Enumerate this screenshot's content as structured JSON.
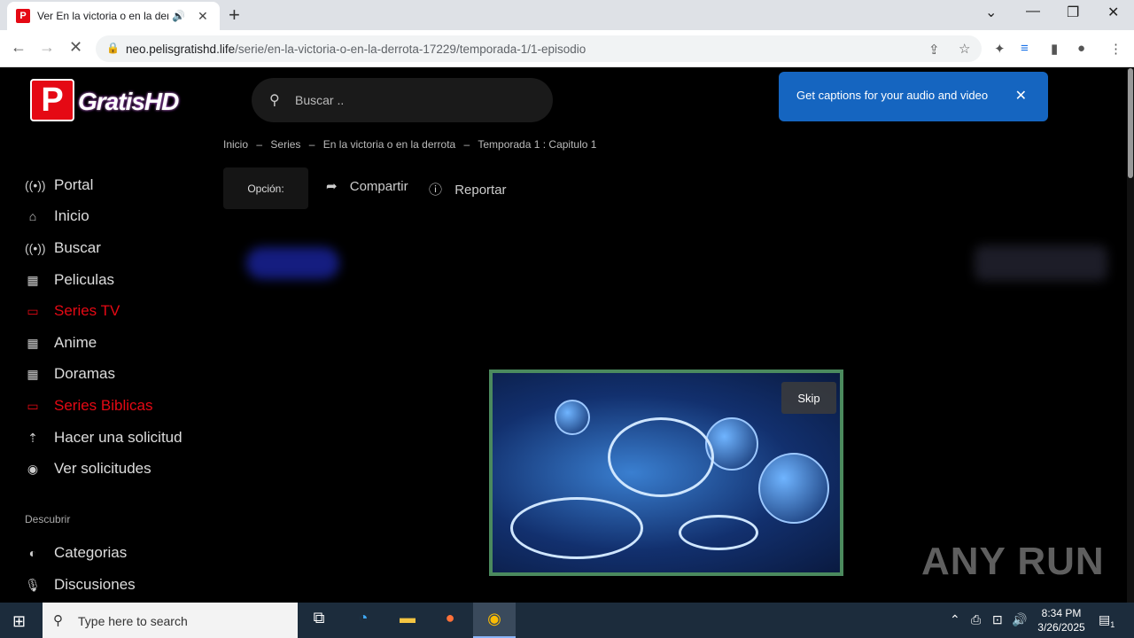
{
  "browser": {
    "tab_title": "Ver En la victoria o en la derr",
    "favicon_letter": "P",
    "audio_icon": "speaker-icon",
    "url_host": "neo.pelisgratishd.life",
    "url_path": "/serie/en-la-victoria-o-en-la-derrota-17229/temporada-1/1-episodio"
  },
  "site": {
    "logo_letter": "P",
    "logo_text": "GratisHD",
    "search_placeholder": "Buscar ..",
    "captions_popup": {
      "text": "Get captions for your audio and video",
      "close": "✕"
    },
    "breadcrumb": {
      "items": [
        "Inicio",
        "Series",
        "En la victoria o en la derrota",
        "Temporada 1 : Capitulo 1"
      ],
      "separator": "–"
    },
    "actions": {
      "option_label": "Opción:",
      "share_label": "Compartir",
      "report_label": "Reportar"
    },
    "sidebar": {
      "items": [
        {
          "label": "Portal",
          "icon": "broadcast-icon",
          "highlight": false
        },
        {
          "label": "Inicio",
          "icon": "home-icon",
          "highlight": false
        },
        {
          "label": "Buscar",
          "icon": "broadcast-icon",
          "highlight": false
        },
        {
          "label": "Peliculas",
          "icon": "film-icon",
          "highlight": false
        },
        {
          "label": "Series TV",
          "icon": "tv-icon",
          "highlight": true
        },
        {
          "label": "Anime",
          "icon": "film-icon",
          "highlight": false
        },
        {
          "label": "Doramas",
          "icon": "film-icon",
          "highlight": false
        },
        {
          "label": "Series Biblicas",
          "icon": "tv-icon",
          "highlight": true
        },
        {
          "label": "Hacer una solicitud",
          "icon": "upload-icon",
          "highlight": false
        },
        {
          "label": "Ver solicitudes",
          "icon": "eye-icon",
          "highlight": false
        }
      ],
      "section_title": "Descubrir",
      "discover_items": [
        {
          "label": "Categorias",
          "icon": "half-circle-icon"
        },
        {
          "label": "Discusiones",
          "icon": "microphone-icon"
        }
      ]
    },
    "ad": {
      "skip_label": "Skip"
    },
    "watermark": "ANY RUN"
  },
  "taskbar": {
    "search_placeholder": "Type here to search",
    "time": "8:34 PM",
    "date": "3/26/2025",
    "notification_count": "1"
  },
  "colors": {
    "accent_red": "#e50914",
    "captions_blue": "#1565c0",
    "video_border": "#4b8a5e"
  }
}
